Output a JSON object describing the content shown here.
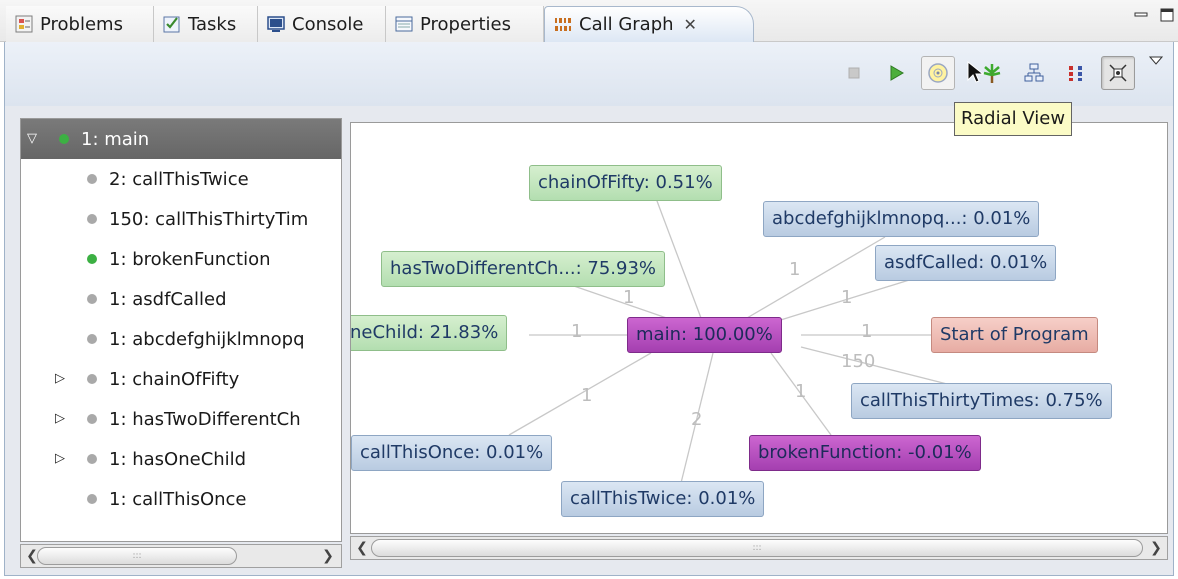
{
  "tabs": [
    {
      "label": "Problems",
      "icon": "problems-icon"
    },
    {
      "label": "Tasks",
      "icon": "tasks-icon"
    },
    {
      "label": "Console",
      "icon": "console-icon"
    },
    {
      "label": "Properties",
      "icon": "properties-icon"
    },
    {
      "label": "Call Graph",
      "icon": "call-graph-icon",
      "active": true
    }
  ],
  "toolbar": {
    "buttons": [
      "stop-icon",
      "play-icon",
      "radial-view-icon",
      "tree-view-icon",
      "level-view-icon",
      "aggregate-view-icon",
      "collapse-mode-icon",
      "view-menu-icon"
    ],
    "tooltip": "Radial View"
  },
  "tree": {
    "items": [
      {
        "label": "1: main",
        "expanded": true,
        "selected": true,
        "dot": "#3cb043"
      },
      {
        "label": "2: callThisTwice",
        "dot": "#a9a9a9"
      },
      {
        "label": "150: callThisThirtyTim",
        "dot": "#a9a9a9"
      },
      {
        "label": "1: brokenFunction",
        "dot": "#3cb043"
      },
      {
        "label": "1: asdfCalled",
        "dot": "#a9a9a9"
      },
      {
        "label": "1: abcdefghijklmnopq",
        "dot": "#a9a9a9"
      },
      {
        "label": "1: chainOfFifty",
        "collapsed": true,
        "dot": "#a9a9a9"
      },
      {
        "label": "1: hasTwoDifferentCh",
        "collapsed": true,
        "dot": "#a9a9a9"
      },
      {
        "label": "1: hasOneChild",
        "collapsed": true,
        "dot": "#a9a9a9"
      },
      {
        "label": "1: callThisOnce",
        "dot": "#a9a9a9"
      }
    ]
  },
  "graph": {
    "center": {
      "label": "main: 100.00%"
    },
    "nodes": [
      {
        "id": "chainOfFifty",
        "label": "chainOfFifty: 0.51%",
        "style": "green",
        "edge": ""
      },
      {
        "id": "abcdef",
        "label": "abcdefghijklmnopq...: 0.01%",
        "style": "blue",
        "edge": "1"
      },
      {
        "id": "hasTwo",
        "label": "hasTwoDifferentCh...: 75.93%",
        "style": "green",
        "edge": "1"
      },
      {
        "id": "asdf",
        "label": "asdfCalled: 0.01%",
        "style": "blue",
        "edge": "1"
      },
      {
        "id": "hasOne",
        "label": "neChild: 21.83%",
        "style": "green",
        "edge": "1"
      },
      {
        "id": "start",
        "label": "Start of Program",
        "style": "salmon",
        "edge": "1"
      },
      {
        "id": "thirty",
        "label": "callThisThirtyTimes: 0.75%",
        "style": "blue",
        "edge": "150"
      },
      {
        "id": "once",
        "label": "callThisOnce: 0.01%",
        "style": "blue",
        "edge": "1"
      },
      {
        "id": "broken",
        "label": "brokenFunction: -0.01%",
        "style": "purple",
        "edge": "1"
      },
      {
        "id": "twice",
        "label": "callThisTwice: 0.01%",
        "style": "blue",
        "edge": "2"
      }
    ]
  },
  "colors": {
    "selection": "#6e6e6e",
    "node_green": "#c4e6be",
    "node_blue": "#c9d8ea",
    "node_purple": "#b84ec2",
    "node_salmon": "#eebdb5",
    "tooltip": "#fbfbc6"
  }
}
